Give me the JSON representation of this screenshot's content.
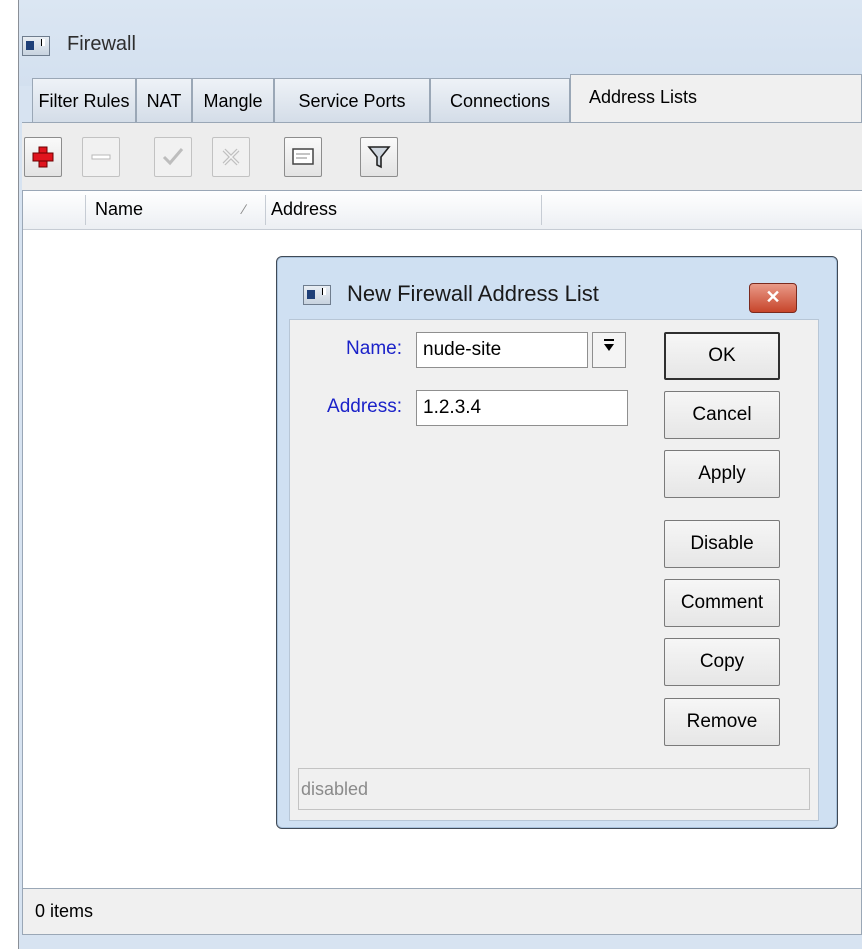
{
  "window": {
    "title": "Firewall",
    "tabs": [
      {
        "label": "Filter Rules",
        "active": false
      },
      {
        "label": "NAT",
        "active": false
      },
      {
        "label": "Mangle",
        "active": false
      },
      {
        "label": "Service Ports",
        "active": false
      },
      {
        "label": "Connections",
        "active": false
      },
      {
        "label": "Address Lists",
        "active": true
      }
    ],
    "toolbar": {
      "add_icon": "plus-icon",
      "remove_icon": "minus-icon",
      "enable_icon": "check-icon",
      "disable_icon": "cross-icon",
      "comment_icon": "note-icon",
      "filter_icon": "filter-icon",
      "accent_color": "#e0141e"
    },
    "list": {
      "columns": [
        "Name",
        "Address"
      ],
      "sort_indicator": "∕"
    },
    "status": "0 items"
  },
  "dialog": {
    "title": "New Firewall Address List",
    "close_icon": "close-icon",
    "fields": {
      "name_label": "Name:",
      "name_value": "nude-site",
      "address_label": "Address:",
      "address_value": "1.2.3.4"
    },
    "buttons": {
      "ok": "OK",
      "cancel": "Cancel",
      "apply": "Apply",
      "disable": "Disable",
      "comment": "Comment",
      "copy": "Copy",
      "remove": "Remove"
    },
    "status": "disabled",
    "label_color": "#1b22c9"
  }
}
